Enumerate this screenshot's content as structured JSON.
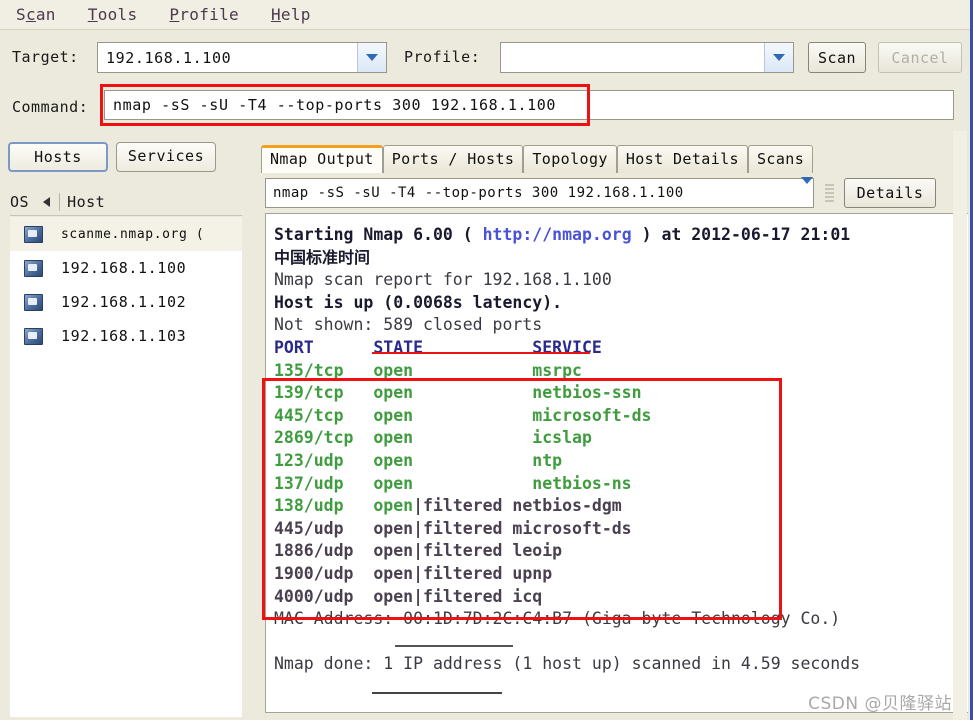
{
  "menu": {
    "items": [
      {
        "pre": "S",
        "mn": "c",
        "post": "an"
      },
      {
        "pre": "",
        "mn": "T",
        "post": "ools"
      },
      {
        "pre": "",
        "mn": "P",
        "post": "rofile"
      },
      {
        "pre": "",
        "mn": "H",
        "post": "elp"
      }
    ]
  },
  "toolbar": {
    "target_label": "Target:",
    "target_value": "192.168.1.100",
    "profile_label": "Profile:",
    "profile_value": "",
    "scan_button": "Scan",
    "cancel_button": "Cancel",
    "command_label": "Command:",
    "command_value": "nmap -sS -sU -T4 --top-ports 300 192.168.1.100"
  },
  "sidebar": {
    "hosts_button": "Hosts",
    "services_button": "Services",
    "col_os": "OS",
    "col_host": "Host",
    "hosts": [
      {
        "name": "scanme.nmap.org (",
        "selected": true,
        "small": true
      },
      {
        "name": "192.168.1.100",
        "selected": false,
        "small": false
      },
      {
        "name": "192.168.1.102",
        "selected": false,
        "small": false
      },
      {
        "name": "192.168.1.103",
        "selected": false,
        "small": false
      }
    ]
  },
  "tabs": [
    {
      "label": "Nmap Output",
      "active": true
    },
    {
      "label": "Ports / Hosts",
      "active": false
    },
    {
      "label": "Topology",
      "active": false
    },
    {
      "label": "Host Details",
      "active": false
    },
    {
      "label": "Scans",
      "active": false
    }
  ],
  "output_toolbar": {
    "command_select": "nmap -sS -sU -T4 --top-ports 300 192.168.1.100",
    "details_button": "Details"
  },
  "output": {
    "lines": [
      {
        "cls": "c-dark",
        "text": "Starting Nmap 6.00 ( ",
        "runs": [
          {
            "c": "c-dark",
            "t": "Starting Nmap 6.00 ( "
          },
          {
            "c": "c-link",
            "t": "http://nmap.org"
          },
          {
            "c": "c-dark",
            "t": " ) at 2012-06-17 21:01"
          }
        ]
      },
      {
        "cjk": true,
        "cls": "c-dark",
        "text": "中国标准时间"
      },
      {
        "cls": "c-plain",
        "text": "Nmap scan report for 192.168.1.100"
      },
      {
        "cls": "c-dark",
        "text": "Host is up (0.0068s latency)."
      },
      {
        "cls": "c-plain",
        "text": "Not shown: 589 closed ports"
      },
      {
        "cls": "c-hdr",
        "text": "PORT      STATE           SERVICE"
      },
      {
        "cls": "c-open",
        "text": "135/tcp   open            msrpc"
      },
      {
        "cls": "c-open",
        "text": "139/tcp   open            netbios-ssn"
      },
      {
        "cls": "c-open",
        "text": "445/tcp   open            microsoft-ds"
      },
      {
        "cls": "c-open",
        "text": "2869/tcp  open            icslap"
      },
      {
        "cls": "c-open",
        "text": "123/udp   open            ntp"
      },
      {
        "cls": "c-open",
        "text": "137/udp   open            netbios-ns"
      },
      {
        "cls": "c-filt",
        "text": "138/udp   open|filtered netbios-dgm",
        "runs": [
          {
            "c": "c-open",
            "t": "138/udp   open"
          },
          {
            "c": "c-filt",
            "t": "|filtered netbios-dgm"
          }
        ]
      },
      {
        "cls": "c-filt",
        "text": "445/udp   open|filtered microsoft-ds"
      },
      {
        "cls": "c-filt",
        "text": "1886/udp  open|filtered leoip"
      },
      {
        "cls": "c-filt",
        "text": "1900/udp  open|filtered upnp"
      },
      {
        "cls": "c-filt",
        "text": "4000/udp  open|filtered icq"
      },
      {
        "cls": "c-plain",
        "text": "MAC Address: 00:1D:7D:2C:C4:B7 (Giga-byte Technology Co.)"
      },
      {
        "cls": "c-blank",
        "text": " "
      },
      {
        "cls": "c-plain",
        "text": "Nmap done: 1 IP address (1 host up) scanned in 4.59 seconds"
      }
    ]
  },
  "annotations": {
    "color": "#ee1111",
    "underline_not_shown": "589 closed ports",
    "underline_mac": "00:1D:7D:2C",
    "underline_done": "1 IP address"
  },
  "watermark": "CSDN @贝隆驿站"
}
